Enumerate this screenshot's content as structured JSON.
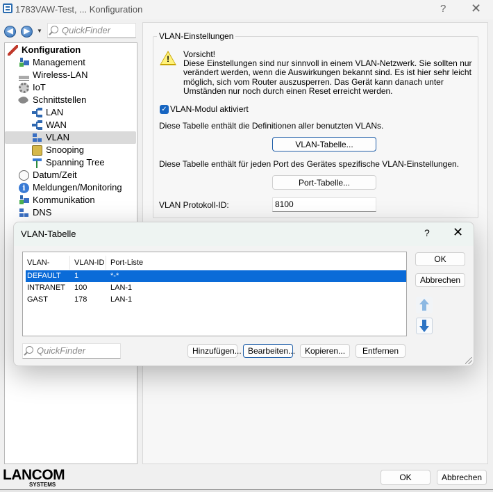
{
  "window": {
    "title": "1783VAW-Test, ... Konfiguration",
    "help_label": "?",
    "close_label": "✕"
  },
  "nav": {
    "back_icon": "◀",
    "forward_icon": "▶",
    "dropdown_icon": "▼",
    "quickfinder_placeholder": "QuickFinder"
  },
  "tree": {
    "items": [
      {
        "label": "Konfiguration",
        "icon": "config-icon",
        "level": 0
      },
      {
        "label": "Management",
        "icon": "management-icon",
        "level": 1
      },
      {
        "label": "Wireless-LAN",
        "icon": "wireless-icon",
        "level": 1
      },
      {
        "label": "IoT",
        "icon": "gear-icon",
        "level": 1
      },
      {
        "label": "Schnittstellen",
        "icon": "plug-icon",
        "level": 1
      },
      {
        "label": "LAN",
        "icon": "lan-icon",
        "level": 2
      },
      {
        "label": "WAN",
        "icon": "wan-icon",
        "level": 2
      },
      {
        "label": "VLAN",
        "icon": "vlan-icon",
        "level": 2,
        "selected": true
      },
      {
        "label": "Snooping",
        "icon": "snooping-icon",
        "level": 2
      },
      {
        "label": "Spanning Tree",
        "icon": "spanning-tree-icon",
        "level": 2
      },
      {
        "label": "Datum/Zeit",
        "icon": "clock-icon",
        "level": 1
      },
      {
        "label": "Meldungen/Monitoring",
        "icon": "info-icon",
        "level": 1
      },
      {
        "label": "Kommunikation",
        "icon": "communication-icon",
        "level": 1
      },
      {
        "label": "DNS",
        "icon": "dns-icon",
        "level": 1
      }
    ]
  },
  "settings": {
    "group_title": "VLAN-Einstellungen",
    "warning_title": "Vorsicht!",
    "warning_body": "Diese Einstellungen sind nur sinnvoll in einem VLAN-Netzwerk. Sie sollten nur verändert werden, wenn die Auswirkungen bekannt sind. Es ist hier sehr leicht möglich, sich vom Router auszusperren. Das Gerät kann danach unter Umständen nur noch durch einen Reset erreicht werden.",
    "vlan_module_label": "VLAN-Modul aktiviert",
    "vlan_module_checked": true,
    "vlan_table_desc": "Diese Tabelle enthält die Definitionen aller benutzten VLANs.",
    "vlan_table_button": "VLAN-Tabelle...",
    "port_table_desc": "Diese Tabelle enthält für jeden Port des Gerätes spezifische VLAN-Einstellungen.",
    "port_table_button": "Port-Tabelle...",
    "protocol_id_label": "VLAN Protokoll-ID:",
    "protocol_id_value": "8100"
  },
  "dialog": {
    "title": "VLAN-Tabelle",
    "help_label": "?",
    "close_label": "✕",
    "columns": [
      "VLAN-Name",
      "VLAN-ID",
      "Port-Liste"
    ],
    "rows": [
      {
        "name": "DEFAULT",
        "id": "1",
        "ports": "*-*",
        "selected": true
      },
      {
        "name": "INTRANET",
        "id": "100",
        "ports": "LAN-1"
      },
      {
        "name": "GAST",
        "id": "178",
        "ports": "LAN-1"
      }
    ],
    "ok_label": "OK",
    "cancel_label": "Abbrechen",
    "quickfinder_placeholder": "QuickFinder",
    "add_label": "Hinzufügen...",
    "edit_label": "Bearbeiten...",
    "copy_label": "Kopieren...",
    "remove_label": "Entfernen"
  },
  "footer": {
    "logo_main": "LANCOM",
    "logo_sub": "SYSTEMS",
    "ok_label": "OK",
    "cancel_label": "Abbrechen"
  }
}
